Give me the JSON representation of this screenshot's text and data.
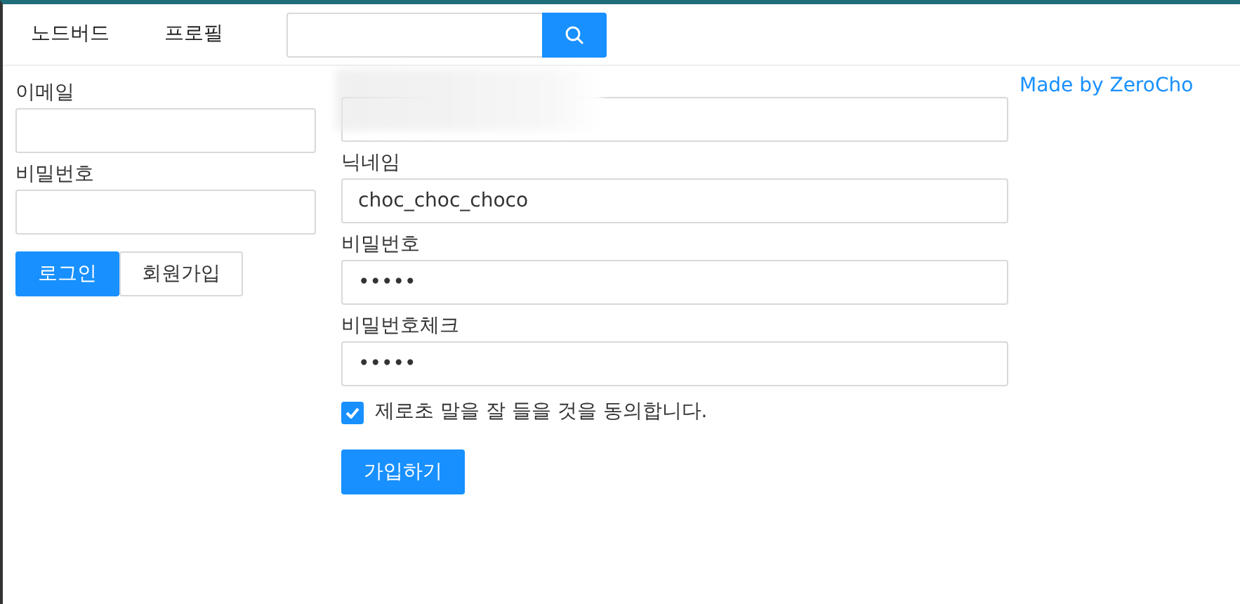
{
  "menu": [
    {
      "label": "노드버드",
      "selected": false
    },
    {
      "label": "프로필",
      "selected": false
    }
  ],
  "login": {
    "fields": [
      {
        "label": "이메일"
      },
      {
        "label": "비밀번호"
      }
    ],
    "buttons": [
      {
        "label": "로그인",
        "kind": "primary"
      },
      {
        "label": "회원가입",
        "kind": "default"
      }
    ]
  },
  "signup": {
    "email_field": {
      "redacted": true
    },
    "fields": [
      {
        "label": "닉네임",
        "value": "choc_choc_choco"
      },
      {
        "label": "비밀번호",
        "value": "•••••"
      },
      {
        "label": "비밀번호체크",
        "value": "•••••"
      }
    ],
    "agree": {
      "label": "제로초 말을 잘 들을 것을 동의합니다.",
      "checked": true
    },
    "submit": "가입하기"
  },
  "credit": "Made by ZeroCho"
}
